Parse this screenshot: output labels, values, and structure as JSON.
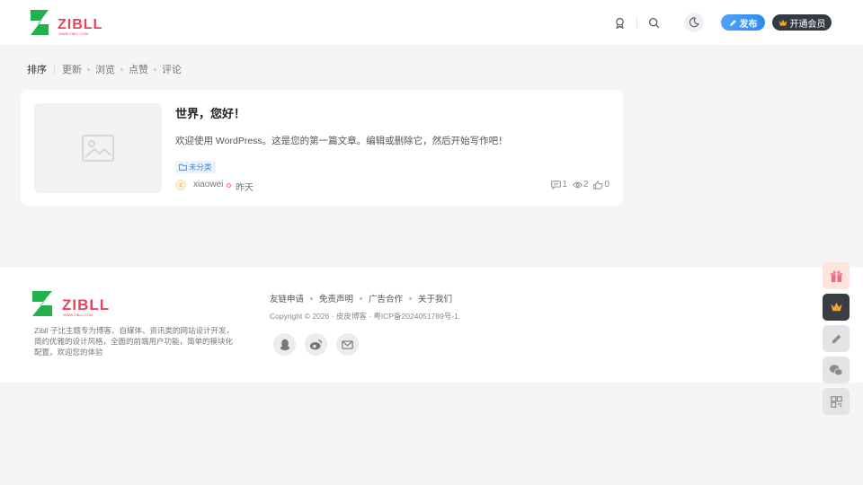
{
  "header": {
    "logo_text": "ZIBLL",
    "logo_sub": "WWW.ZIBLL.COM",
    "publish_label": "发布",
    "vip_label": "开通会员"
  },
  "sort": {
    "title": "排序",
    "options": [
      "更新",
      "浏览",
      "点赞",
      "评论"
    ]
  },
  "post": {
    "title": "世界，您好！",
    "excerpt": "欢迎使用 WordPress。这是您的第一篇文章。编辑或删除它，然后开始写作吧！",
    "tag": "未分类",
    "author": "xiaowei",
    "time": "昨天",
    "comments": "1",
    "views": "2",
    "likes": "0"
  },
  "footer": {
    "logo_text": "ZIBLL",
    "logo_sub": "WWW.ZIBLL.COM",
    "description": "Zibll 子比主题专为博客、自媒体、资讯类的网站设计开发，简约优雅的设计风格，全面的前端用户功能，简单的模块化配置，欢迎您的体验",
    "links": [
      "友链申请",
      "免责声明",
      "广告合作",
      "关于我们"
    ],
    "copyright": "Copyright © 2026 · 皮皮博客 · 粤ICP备2024051789号-1."
  },
  "colors": {
    "brand_green": "#23b14d",
    "brand_red": "#e8435a",
    "publish_blue": "#2d8cf0",
    "vip_dark": "#333a42"
  }
}
